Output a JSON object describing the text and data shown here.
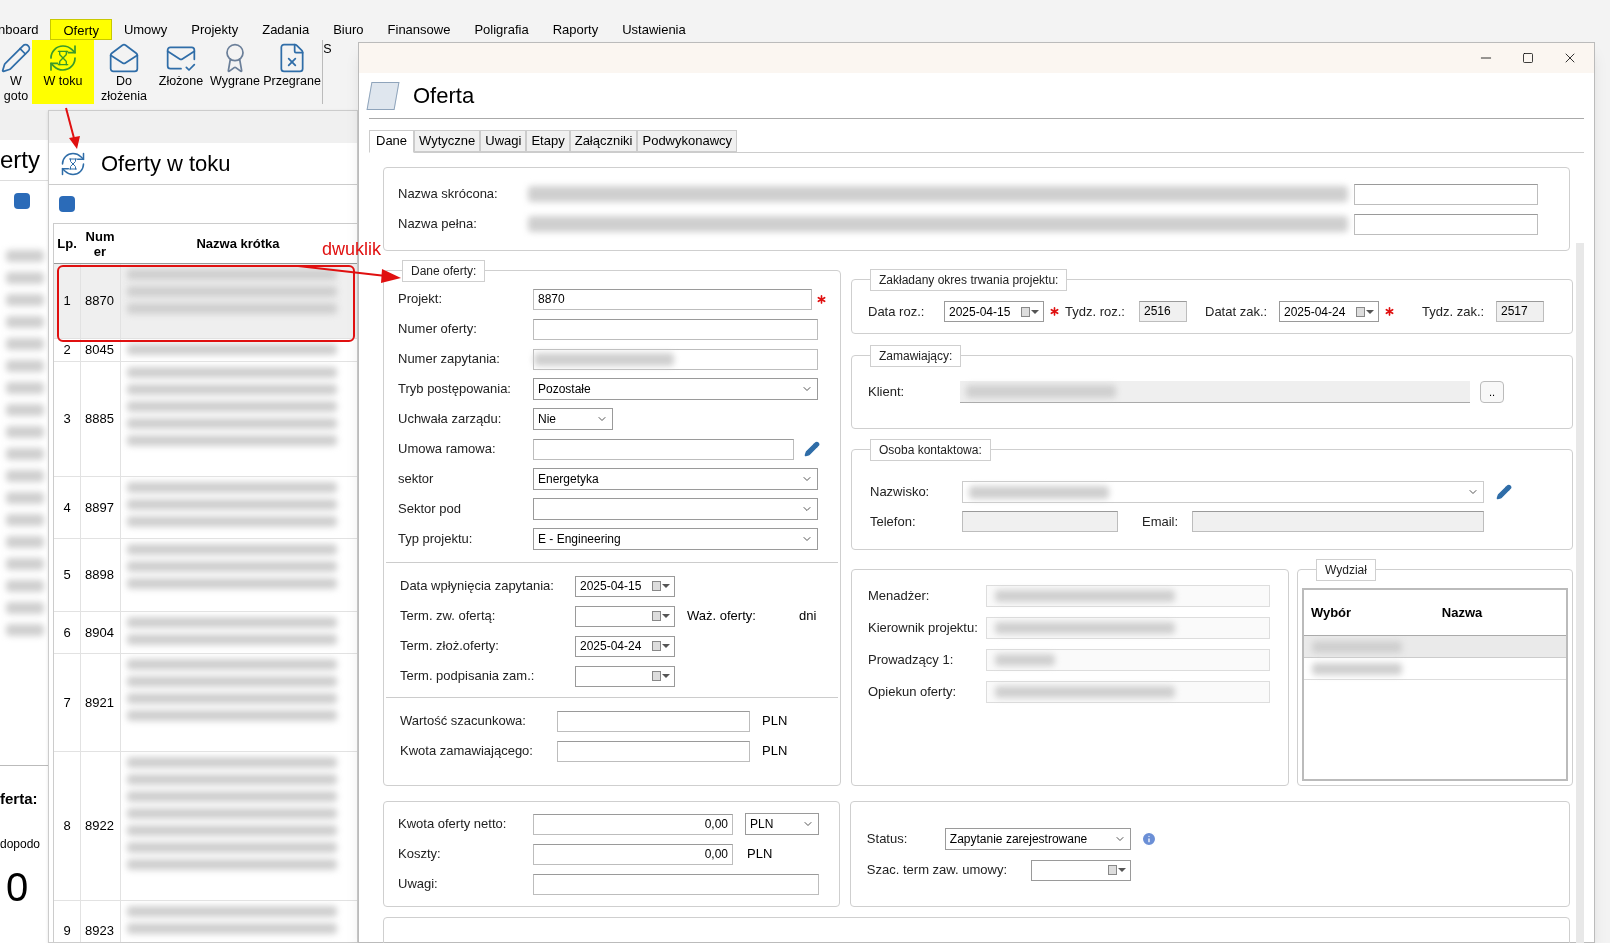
{
  "menu": [
    {
      "label": "nboard",
      "selected": false
    },
    {
      "label": "Oferty",
      "selected": true
    },
    {
      "label": "Umowy",
      "selected": false
    },
    {
      "label": "Projekty",
      "selected": false
    },
    {
      "label": "Zadania",
      "selected": false
    },
    {
      "label": "Biuro",
      "selected": false
    },
    {
      "label": "Finansowe",
      "selected": false
    },
    {
      "label": "Poligrafia",
      "selected": false
    },
    {
      "label": "Raporty",
      "selected": false
    },
    {
      "label": "Ustawienia",
      "selected": false
    }
  ],
  "toolbar": [
    {
      "label": "W goto",
      "kind": "pencil",
      "selected": false
    },
    {
      "label": "W toku",
      "kind": "hourglass",
      "selected": true
    },
    {
      "label": "Do złożenia",
      "kind": "mail-open",
      "selected": false
    },
    {
      "label": "Złożone",
      "kind": "mail-check",
      "selected": false
    },
    {
      "label": "Wygrane",
      "kind": "award",
      "selected": false
    },
    {
      "label": "Przegrane",
      "kind": "file-x",
      "selected": false
    },
    {
      "label": "S",
      "kind": "none",
      "selected": false
    }
  ],
  "back_window": {
    "title": "erty",
    "summary_title": "ferta:",
    "summary_label": "dopodo",
    "summary_value": "0"
  },
  "list_window": {
    "title": "Oferty w toku",
    "columns": [
      "Lp.",
      "Numer",
      "Nazwa krótka"
    ],
    "rows": [
      {
        "lp": "1",
        "numer": "8870",
        "selected": true
      },
      {
        "lp": "2",
        "numer": "8045",
        "selected": false
      },
      {
        "lp": "3",
        "numer": "8885",
        "selected": false
      },
      {
        "lp": "4",
        "numer": "8897",
        "selected": false
      },
      {
        "lp": "5",
        "numer": "8898",
        "selected": false
      },
      {
        "lp": "6",
        "numer": "8904",
        "selected": false
      },
      {
        "lp": "7",
        "numer": "8921",
        "selected": false
      },
      {
        "lp": "8",
        "numer": "8922",
        "selected": false
      },
      {
        "lp": "9",
        "numer": "8923",
        "selected": false
      }
    ]
  },
  "annotation": {
    "text": "dwuklik"
  },
  "dialog": {
    "title": "Oferta",
    "tabs": [
      {
        "label": "Dane",
        "selected": true
      },
      {
        "label": "Wytyczne",
        "selected": false
      },
      {
        "label": "Uwagi",
        "selected": false
      },
      {
        "label": "Etapy",
        "selected": false
      },
      {
        "label": "Załączniki",
        "selected": false
      },
      {
        "label": "Podwykonawcy",
        "selected": false
      }
    ],
    "names": [
      {
        "label": "Nazwa skrócona:"
      },
      {
        "label": "Nazwa pełna:"
      }
    ],
    "dane_oferty": {
      "legend": "Dane oferty:",
      "fields": [
        {
          "label": "Projekt:",
          "kind": "text",
          "value": "8870",
          "required": true
        },
        {
          "label": "Numer oferty:",
          "kind": "text",
          "required": false
        },
        {
          "label": "Numer zapytania:",
          "kind": "redacted",
          "required": false
        },
        {
          "label": "Tryb postępowania:",
          "kind": "select",
          "value": "Pozostałe",
          "required": false
        },
        {
          "label": "Uchwała zarządu:",
          "kind": "small-select",
          "value": "Nie",
          "required": false
        },
        {
          "label": "Umowa ramowa:",
          "kind": "edit",
          "required": false
        },
        {
          "label": "sektor",
          "kind": "select",
          "value": "Energetyka",
          "required": false
        },
        {
          "label": "Sektor pod",
          "kind": "select",
          "required": false
        },
        {
          "label": "Typ projektu:",
          "kind": "select",
          "value": "E - Engineering",
          "required": false
        }
      ],
      "dates": [
        {
          "label": "Data wpłynięcia zapytania:",
          "value": "2025-04-15"
        },
        {
          "label": "Term. zw. ofertą:",
          "extra_label": "Waż. oferty:",
          "extra_unit": "dni"
        },
        {
          "label": "Term. złoż.oferty:",
          "value": "2025-04-24"
        },
        {
          "label": "Term. podpisania zam.:"
        }
      ],
      "amounts": [
        {
          "label": "Wartość szacunkowa:",
          "unit": "PLN"
        },
        {
          "label": "Kwota zamawiającego:",
          "unit": "PLN"
        }
      ]
    },
    "okres": {
      "legend": "Zakładany okres trwania projektu:",
      "start_label": "Data roz.:",
      "start": "2025-04-15",
      "start_required": true,
      "week_start_label": "Tydz. roz.:",
      "week_start": "2516",
      "end_label": "Datat zak.:",
      "end": "2025-04-24",
      "end_required": true,
      "week_end_label": "Tydz. zak.:",
      "week_end": "2517"
    },
    "zamawiajacy": {
      "legend": "Zamawiający:",
      "label": "Klient:",
      "button": ".."
    },
    "osoba": {
      "legend": "Osoba kontaktowa:",
      "surname_label": "Nazwisko:",
      "phone_label": "Telefon:",
      "email_label": "Email:"
    },
    "people": [
      {
        "label": "Menadżer:"
      },
      {
        "label": "Kierownik projektu:"
      },
      {
        "label": "Prowadzący 1:"
      },
      {
        "label": "Opiekun oferty:"
      }
    ],
    "wydzial": {
      "legend": "Wydział",
      "columns": [
        "Wybór",
        "Nazwa"
      ]
    },
    "costs": [
      {
        "label": "Kwota oferty netto:",
        "kind": "currency-select",
        "value": "0,00",
        "unit": "PLN"
      },
      {
        "label": "Koszty:",
        "kind": "unit",
        "value": "0,00",
        "unit": "PLN"
      },
      {
        "label": "Uwagi:",
        "kind": "text"
      }
    ],
    "status": {
      "label": "Status:",
      "value": "Zapytanie zarejestrowane",
      "date_label": "Szac. term zaw. umowy:"
    }
  }
}
